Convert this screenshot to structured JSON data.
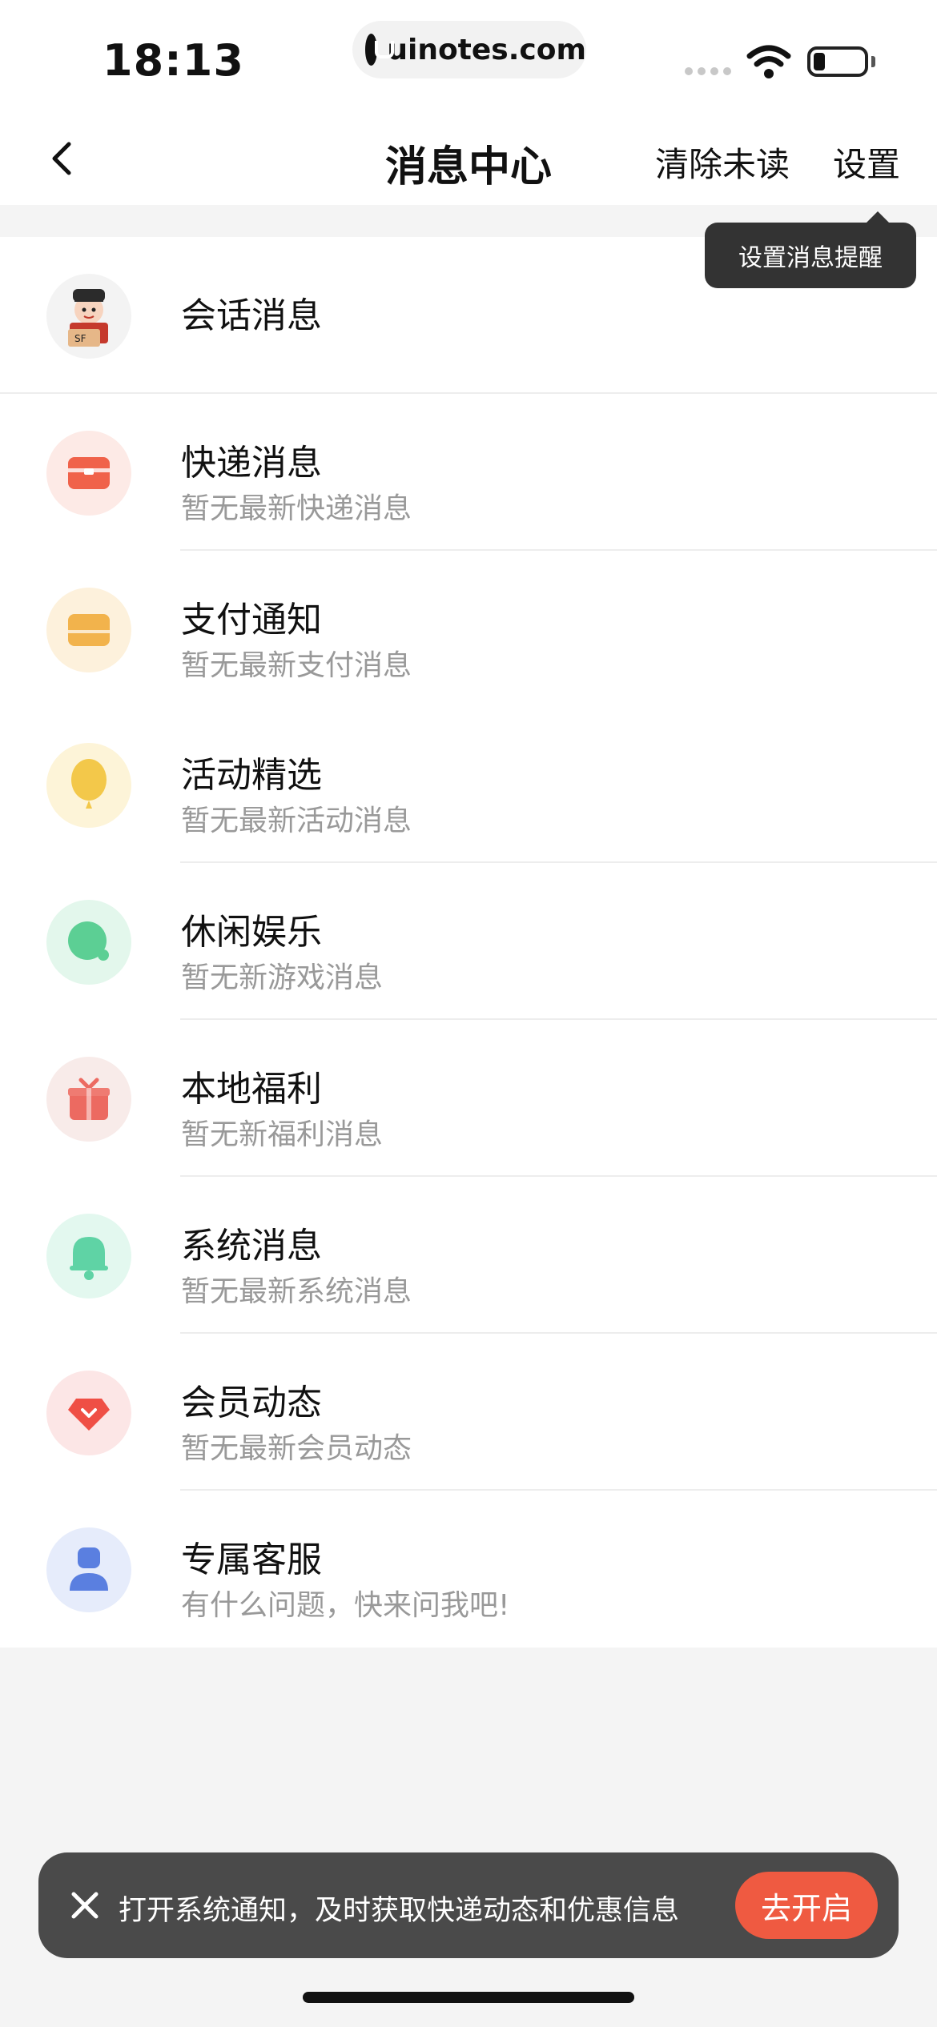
{
  "status_bar": {
    "time": "18:13",
    "url": "uinotes.com"
  },
  "nav": {
    "title": "消息中心",
    "clear_unread": "清除未读",
    "settings": "设置"
  },
  "tooltip": {
    "text": "设置消息提醒"
  },
  "section1": {
    "items": [
      {
        "title": "会话消息",
        "subtitle": "",
        "icon": "courier-avatar-icon"
      },
      {
        "title": "快递消息",
        "subtitle": "暂无最新快递消息",
        "icon": "package-icon"
      },
      {
        "title": "支付通知",
        "subtitle": "暂无最新支付消息",
        "icon": "wallet-icon"
      }
    ]
  },
  "section2": {
    "items": [
      {
        "title": "活动精选",
        "subtitle": "暂无最新活动消息",
        "icon": "balloon-icon"
      },
      {
        "title": "休闲娱乐",
        "subtitle": "暂无新游戏消息",
        "icon": "chat-bubble-icon"
      },
      {
        "title": "本地福利",
        "subtitle": "暂无新福利消息",
        "icon": "gift-icon"
      },
      {
        "title": "系统消息",
        "subtitle": "暂无最新系统消息",
        "icon": "bell-icon"
      },
      {
        "title": "会员动态",
        "subtitle": "暂无最新会员动态",
        "icon": "diamond-icon"
      },
      {
        "title": "专属客服",
        "subtitle": "有什么问题，快来问我吧!",
        "icon": "person-icon"
      }
    ]
  },
  "toast": {
    "text": "打开系统通知，及时获取快递动态和优惠信息",
    "button": "去开启"
  },
  "colors": {
    "accent": "#ef5a41",
    "package": "#f0624a",
    "wallet": "#f2b34c",
    "balloon": "#f3c84a",
    "chat": "#5ccf94",
    "gift": "#ec6a61",
    "bell": "#5fd3a5",
    "diamond": "#ef4f45",
    "person": "#5a7fe0"
  }
}
